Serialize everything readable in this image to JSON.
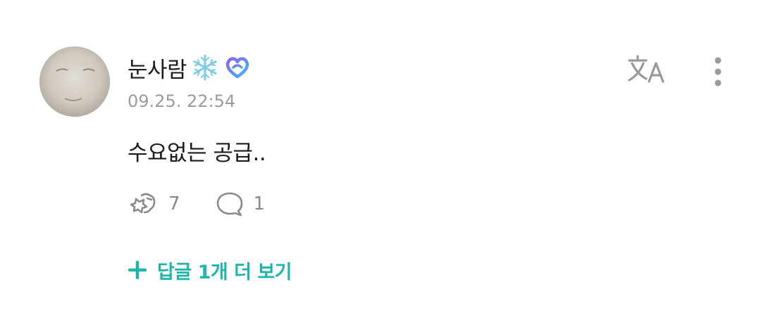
{
  "comment": {
    "author": "눈사람",
    "author_emoji": "snowflake-icon",
    "author_badge": "heart-badge-icon",
    "timestamp": "09.25. 22:54",
    "text": "수요없는 공급..",
    "actions": {
      "like_icon": "like-hand-icon",
      "like_count": "7",
      "reply_icon": "speech-bubble-icon",
      "reply_count": "1"
    },
    "more_replies_label": "답글 1개 더 보기",
    "translate_icon": "translate-icon",
    "more_icon": "more-vertical-icon"
  },
  "colors": {
    "accent": "#1fb5a9",
    "text": "#1b1b1b",
    "muted": "#9b9b9b",
    "snowflake": "#7ecbe8",
    "badge_gradient": [
      "#8a63f0",
      "#3fb6ff"
    ]
  }
}
